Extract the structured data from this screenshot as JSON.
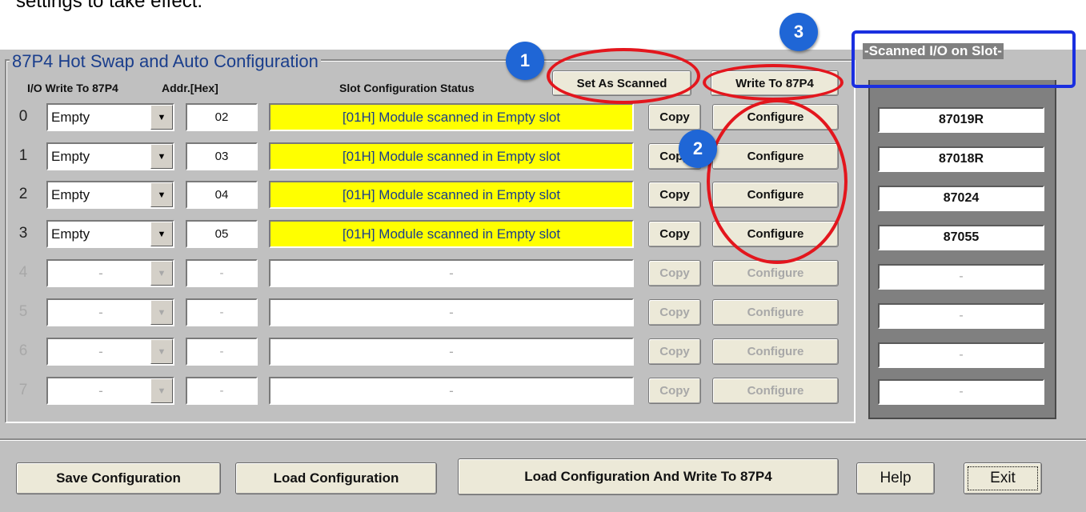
{
  "top_note": "settings to take effect.",
  "group_title": "87P4 Hot Swap and Auto Configuration",
  "headers": {
    "io_write": "I/O Write To 87P4",
    "addr": "Addr.[Hex]",
    "slot_status": "Slot Configuration Status"
  },
  "toolbar": {
    "set_as_scanned": "Set As Scanned",
    "write_to_87p4": "Write To 87P4"
  },
  "rows": [
    {
      "num": "0",
      "io": "Empty",
      "addr": "02",
      "status": "[01H] Module scanned in Empty slot",
      "copy": "Copy",
      "configure": "Configure"
    },
    {
      "num": "1",
      "io": "Empty",
      "addr": "03",
      "status": "[01H] Module scanned in Empty slot",
      "copy": "Copy",
      "configure": "Configure"
    },
    {
      "num": "2",
      "io": "Empty",
      "addr": "04",
      "status": "[01H] Module scanned in Empty slot",
      "copy": "Copy",
      "configure": "Configure"
    },
    {
      "num": "3",
      "io": "Empty",
      "addr": "05",
      "status": "[01H] Module scanned in Empty slot",
      "copy": "Copy",
      "configure": "Configure"
    },
    {
      "num": "4",
      "io": "-",
      "addr": "-",
      "status": "-",
      "copy": "Copy",
      "configure": "Configure"
    },
    {
      "num": "5",
      "io": "-",
      "addr": "-",
      "status": "-",
      "copy": "Copy",
      "configure": "Configure"
    },
    {
      "num": "6",
      "io": "-",
      "addr": "-",
      "status": "-",
      "copy": "Copy",
      "configure": "Configure"
    },
    {
      "num": "7",
      "io": "-",
      "addr": "-",
      "status": "-",
      "copy": "Copy",
      "configure": "Configure"
    }
  ],
  "scanned_panel": {
    "title": "Scanned I/O on Slot",
    "slots": [
      "87019R",
      "87018R",
      "87024",
      "87055",
      "-",
      "-",
      "-",
      "-"
    ]
  },
  "bottom": {
    "save_config": "Save Configuration",
    "load_config": "Load Configuration",
    "load_and_write": "Load  Configuration And Write To 87P4",
    "help": "Help",
    "exit": "Exit"
  },
  "annotations": {
    "step1": "1",
    "step2": "2",
    "step3": "3"
  },
  "colors": {
    "status_active": "#ffff00",
    "title_blue": "#1a3e8c",
    "annotation_red": "#e3161d",
    "annotation_blue": "#1f66d6"
  }
}
